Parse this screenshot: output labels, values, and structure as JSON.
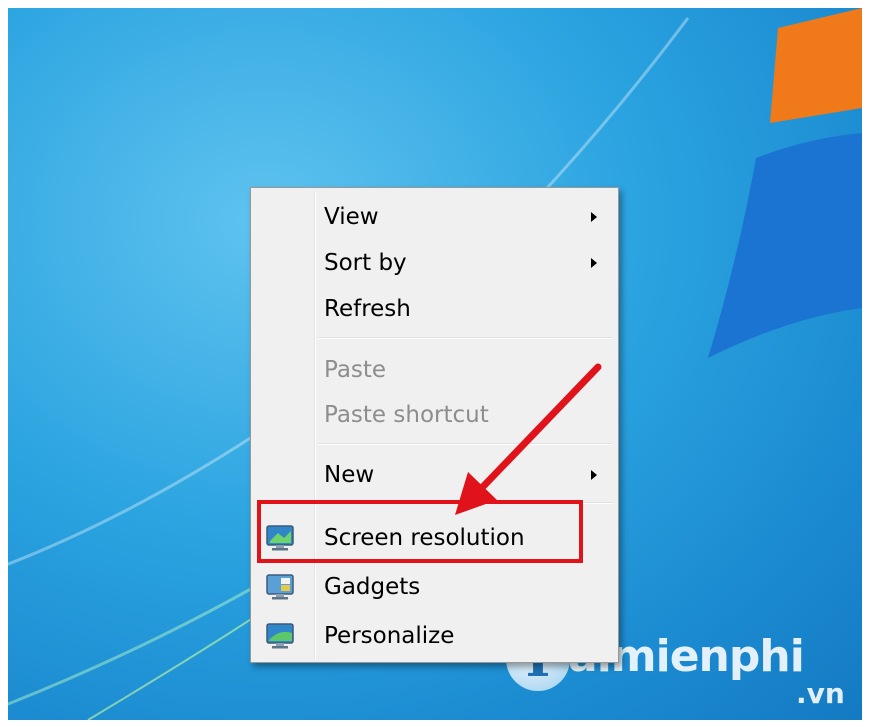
{
  "desktop": {
    "wallpaper": "Windows 7 default",
    "colors": {
      "blue": "#2aa3e0",
      "logo_orange": "#f07a1a",
      "logo_blue": "#1c74d2"
    }
  },
  "context_menu": {
    "items": [
      {
        "label": "View",
        "submenu": true,
        "disabled": false
      },
      {
        "label": "Sort by",
        "submenu": true,
        "disabled": false
      },
      {
        "label": "Refresh",
        "submenu": false,
        "disabled": false
      },
      {
        "label": "Paste",
        "submenu": false,
        "disabled": true
      },
      {
        "label": "Paste shortcut",
        "submenu": false,
        "disabled": true
      },
      {
        "label": "New",
        "submenu": true,
        "disabled": false
      },
      {
        "label": "Screen resolution",
        "submenu": false,
        "disabled": false,
        "icon": "monitor-icon"
      },
      {
        "label": "Gadgets",
        "submenu": false,
        "disabled": false,
        "icon": "gadgets-icon"
      },
      {
        "label": "Personalize",
        "submenu": false,
        "disabled": false,
        "icon": "personalize-icon"
      }
    ]
  },
  "annotation": {
    "color": "#e0131b",
    "target": "Screen resolution"
  },
  "watermark": {
    "brand": "aimienphi",
    "initial": "T",
    "tld": ".vn"
  }
}
